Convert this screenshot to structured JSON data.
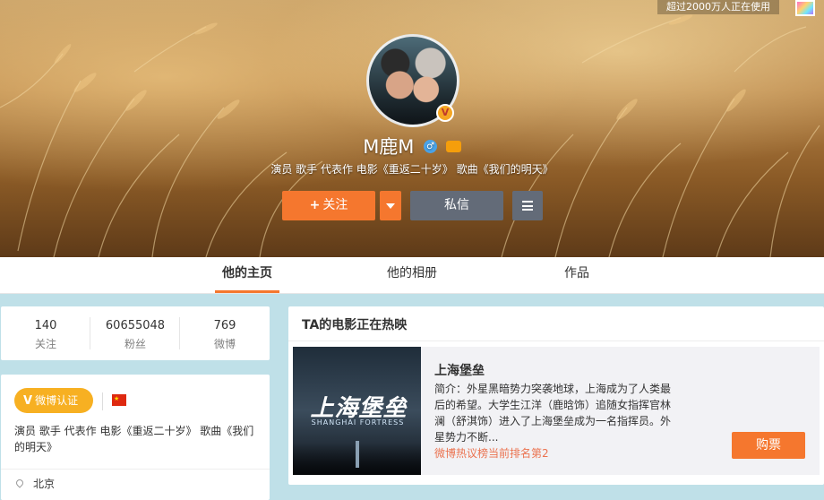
{
  "banner": {
    "top_text": "超过2000万人正在使用",
    "skin_icon": "skin-icon"
  },
  "profile": {
    "name": "M鹿M",
    "gender": "♂",
    "verified_mark": "V",
    "intro": "演员 歌手 代表作 电影《重返二十岁》 歌曲《我们的明天》"
  },
  "actions": {
    "follow_plus": "+",
    "follow_label": "关注",
    "message_label": "私信"
  },
  "tabs": [
    {
      "label": "他的主页",
      "active": true
    },
    {
      "label": "他的相册",
      "active": false
    },
    {
      "label": "作品",
      "active": false
    }
  ],
  "stats": [
    {
      "value": "140",
      "label": "关注"
    },
    {
      "value": "60655048",
      "label": "粉丝"
    },
    {
      "value": "769",
      "label": "微博"
    }
  ],
  "info": {
    "verify_mark": "V",
    "verify_label": "微博认证",
    "intro": "演员 歌手 代表作 电影《重返二十岁》 歌曲《我们的明天》",
    "location": "北京"
  },
  "hot_movie": {
    "section_title": "TA的电影正在热映",
    "poster_title": "上海堡垒",
    "poster_sub": "SHANGHAI FORTRESS",
    "title": "上海堡垒",
    "description": "简介：外星黑暗势力突袭地球，上海成为了人类最后的希望。大学生江洋（鹿晗饰）追随女指挥官林澜（舒淇饰）进入了上海堡垒成为一名指挥员。外星势力不断...",
    "rank": "微博热议榜当前排名第2",
    "buy_label": "购票"
  },
  "colors": {
    "accent": "#f5772e",
    "dark_button": "#636b78",
    "badge": "#f7b022",
    "rank_text": "#eb7350",
    "page_bg": "#bfe0e8"
  }
}
